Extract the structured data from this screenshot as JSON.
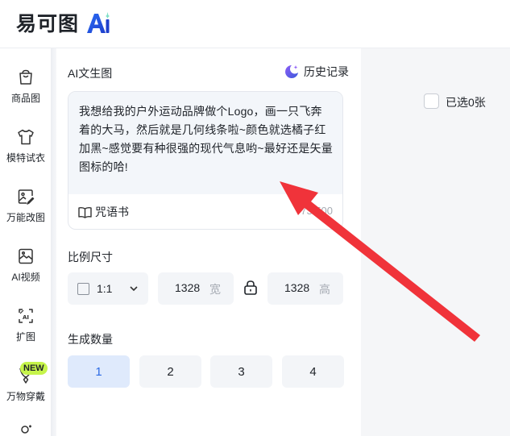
{
  "header": {
    "logo_text": "易可图",
    "logo_ai": "Ai"
  },
  "sidebar": {
    "items": [
      {
        "label": "商品图",
        "icon": "shopping-bag-icon"
      },
      {
        "label": "模特试衣",
        "icon": "tshirt-icon"
      },
      {
        "label": "万能改图",
        "icon": "image-edit-icon"
      },
      {
        "label": "AI视频",
        "icon": "ai-video-icon"
      },
      {
        "label": "扩图",
        "icon": "expand-image-icon"
      },
      {
        "label": "万物穿戴",
        "icon": "necklace-icon"
      }
    ],
    "new_badge": "NEW"
  },
  "panel": {
    "title": "AI文生图",
    "history_label": "历史记录",
    "prompt_text": "我想给我的户外运动品牌做个Logo，画一只飞奔着的大马，然后就是几何线条啦~颜色就选橘子红加黑~感觉要有种很强的现代气息哟~最好还是矢量图标的哈!",
    "spellbook_label": "咒语书",
    "char_count": "73/500",
    "ratio_title": "比例尺寸",
    "ratio_value": "1:1",
    "width_value": "1328",
    "width_unit": "宽",
    "height_value": "1328",
    "height_unit": "高",
    "quantity_title": "生成数量",
    "quantity_options": [
      "1",
      "2",
      "3",
      "4"
    ],
    "quantity_selected": "1"
  },
  "gallery": {
    "selected_label": "已选0张"
  },
  "colors": {
    "accent": "#2d6be4",
    "badge": "#c6f44b",
    "arrow": "#f0333a",
    "active_bg": "#dfeafc"
  }
}
